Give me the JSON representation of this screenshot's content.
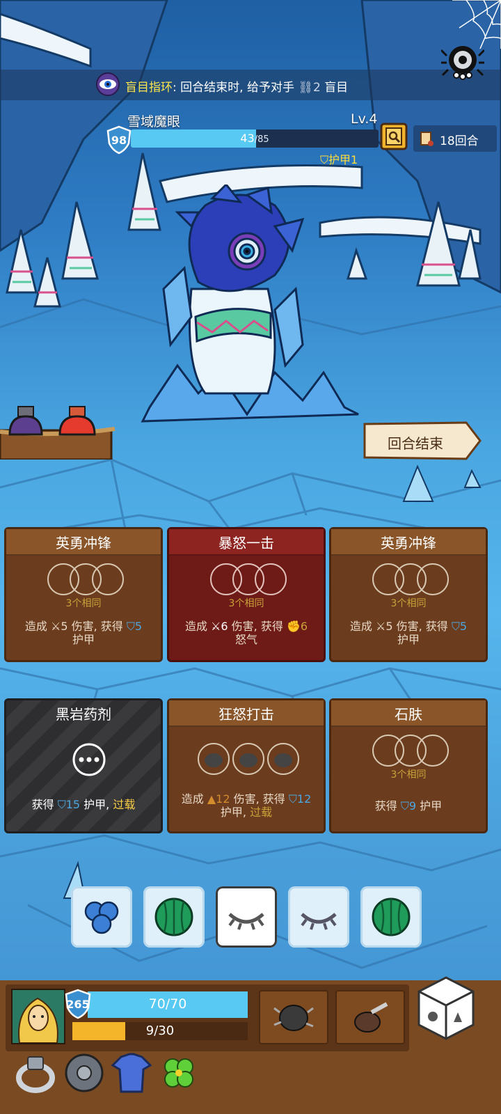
{
  "banner": {
    "effect_name": "盲目指环",
    "effect_text": ": 回合结束时, 给予对手",
    "effect_amount": "2",
    "effect_status": "盲目"
  },
  "enemy": {
    "name": "雪域魔眼",
    "level": "Lv.4",
    "shield": "98",
    "hp_current": "43",
    "hp_max": "/85",
    "hp_fraction": 0.506,
    "armor_tag": "护甲1"
  },
  "turns": {
    "label": "18回合"
  },
  "end_turn": {
    "label": "回合结束"
  },
  "cards": [
    {
      "title": "英勇冲锋",
      "same": "3个相同",
      "desc_a": "造成",
      "n1": "5",
      "desc_b": " 伤害, 获得 ",
      "n2": "5",
      "desc_c": "护甲"
    },
    {
      "title": "暴怒一击",
      "same": "3个相同",
      "desc_a": "造成",
      "n1": "6",
      "desc_b": " 伤害, 获得 ",
      "n2": "6",
      "desc_c": "怒气"
    },
    {
      "title": "英勇冲锋",
      "same": "3个相同",
      "desc_a": "造成",
      "n1": "5",
      "desc_b": " 伤害, 获得 ",
      "n2": "5",
      "desc_c": "护甲"
    },
    {
      "title": "黑岩药剂",
      "desc_a": "获得 ",
      "n1": "15",
      "desc_b": " 护甲, ",
      "overload": "过载"
    },
    {
      "title": "狂怒打击",
      "desc_a": "造成 ",
      "n1": "12",
      "desc_b": " 伤害, 获得 ",
      "n2": "12",
      "desc_c": "护甲, ",
      "overload": "过载"
    },
    {
      "title": "石肤",
      "same": "3个相同",
      "desc_a": "获得 ",
      "n1": "9",
      "desc_b": " 护甲"
    }
  ],
  "dice": [
    "blueberries-icon",
    "watermelon-icon",
    "closed-eye-icon",
    "closed-eye-icon",
    "watermelon-icon"
  ],
  "player": {
    "shield": "265",
    "hp": "70/70",
    "rage": "9/30",
    "rage_fraction": 0.3
  },
  "colors": {
    "hp": "#58c9f2",
    "rage": "#f5b52a",
    "card_brown": "#6b3c1e",
    "card_red": "#6e1a16"
  }
}
